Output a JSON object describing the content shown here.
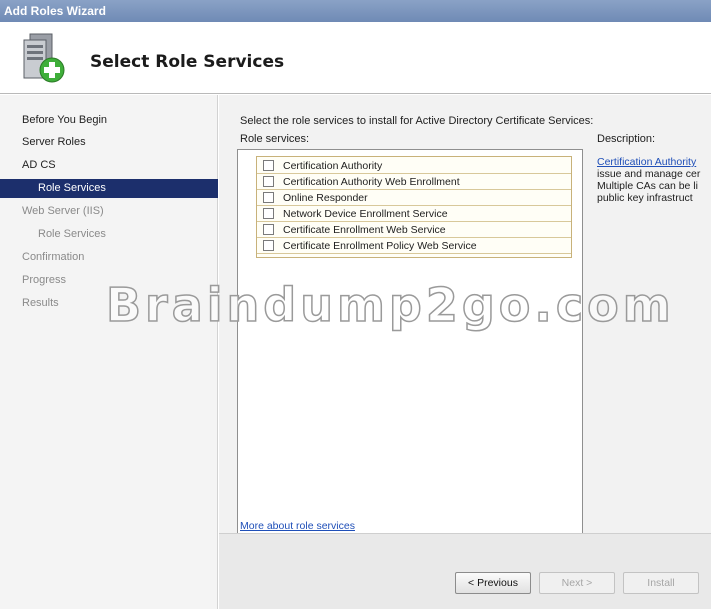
{
  "window": {
    "title": "Add Roles Wizard"
  },
  "header": {
    "title": "Select Role Services",
    "icon": "server-add-icon"
  },
  "nav": {
    "items": [
      {
        "label": "Before You Begin"
      },
      {
        "label": "Server Roles"
      },
      {
        "label": "AD CS"
      },
      {
        "label": "Role Services"
      },
      {
        "label": "Web Server (IIS)"
      },
      {
        "label": "Role Services"
      },
      {
        "label": "Confirmation"
      },
      {
        "label": "Progress"
      },
      {
        "label": "Results"
      }
    ]
  },
  "main": {
    "intro": "Select the role services to install for Active Directory Certificate Services:",
    "role_services_label": "Role services:",
    "description_label": "Description:",
    "role_services": [
      {
        "label": "Certification Authority",
        "checked": false
      },
      {
        "label": "Certification Authority Web Enrollment",
        "checked": false
      },
      {
        "label": "Online Responder",
        "checked": false
      },
      {
        "label": "Network Device Enrollment Service",
        "checked": false
      },
      {
        "label": "Certificate Enrollment Web Service",
        "checked": false
      },
      {
        "label": "Certificate Enrollment Policy Web Service",
        "checked": false
      }
    ],
    "description": {
      "link": "Certification Authority",
      "lines": [
        "issue and manage cer",
        "Multiple CAs can be li",
        "public key infrastruct"
      ]
    },
    "more_link": "More about role services"
  },
  "footer": {
    "previous": "< Previous",
    "next": "Next >",
    "install": "Install"
  },
  "watermark": "Braindump2go.com",
  "colors": {
    "nav_active": "#1c2f6c",
    "link": "#1f4fb8"
  }
}
